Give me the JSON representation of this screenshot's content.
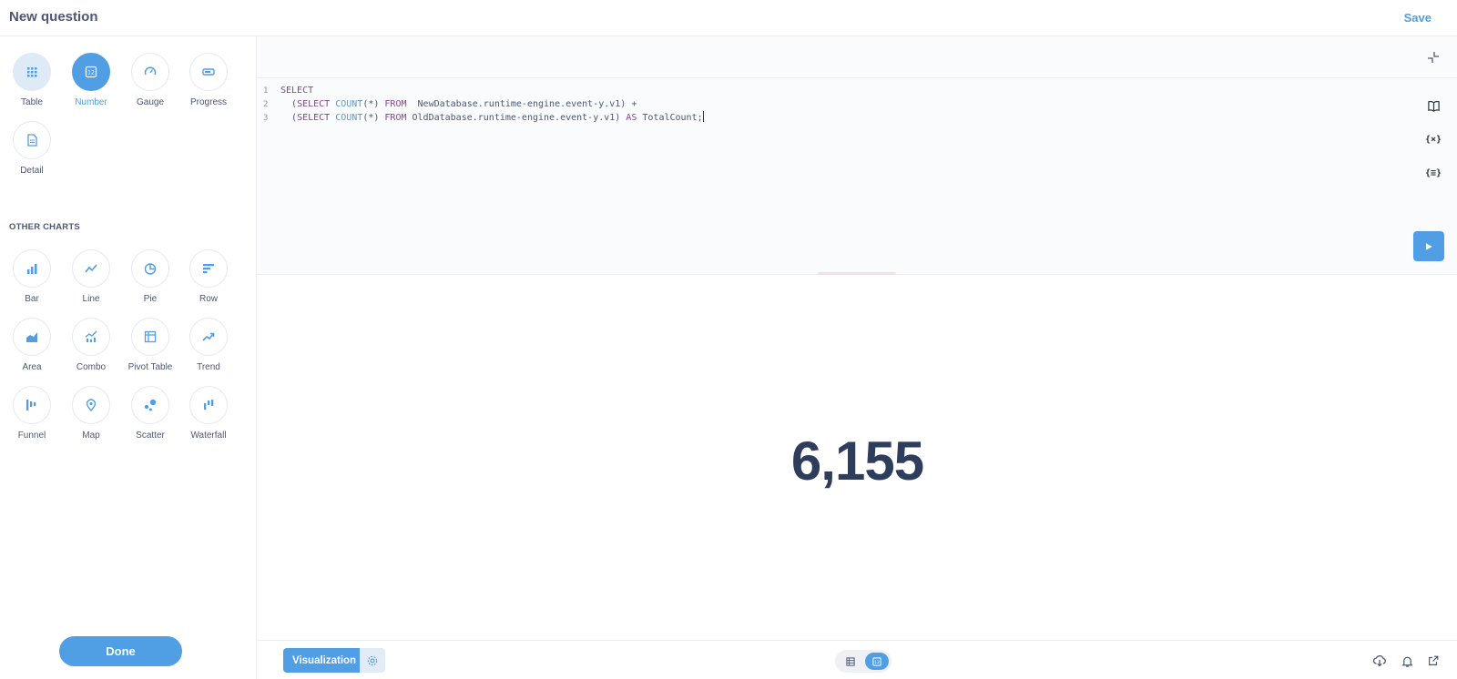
{
  "header": {
    "title": "New question",
    "save_label": "Save"
  },
  "sidebar": {
    "primary_charts": [
      {
        "label": "Table",
        "icon": "table-icon"
      },
      {
        "label": "Number",
        "icon": "number-icon"
      },
      {
        "label": "Gauge",
        "icon": "gauge-icon"
      },
      {
        "label": "Progress",
        "icon": "progress-icon"
      },
      {
        "label": "Detail",
        "icon": "detail-icon"
      }
    ],
    "selected": "Number",
    "other_charts_heading": "OTHER CHARTS",
    "other_charts": [
      {
        "label": "Bar",
        "icon": "bar-chart-icon"
      },
      {
        "label": "Line",
        "icon": "line-chart-icon"
      },
      {
        "label": "Pie",
        "icon": "pie-chart-icon"
      },
      {
        "label": "Row",
        "icon": "row-chart-icon"
      },
      {
        "label": "Area",
        "icon": "area-chart-icon"
      },
      {
        "label": "Combo",
        "icon": "combo-chart-icon"
      },
      {
        "label": "Pivot Table",
        "icon": "pivot-table-icon"
      },
      {
        "label": "Trend",
        "icon": "trend-icon"
      },
      {
        "label": "Funnel",
        "icon": "funnel-icon"
      },
      {
        "label": "Map",
        "icon": "map-pin-icon"
      },
      {
        "label": "Scatter",
        "icon": "scatter-icon"
      },
      {
        "label": "Waterfall",
        "icon": "waterfall-icon"
      }
    ],
    "done_label": "Done"
  },
  "editor": {
    "line_numbers": [
      "1",
      "2",
      "3"
    ],
    "line1": {
      "kw": "SELECT"
    },
    "line2": {
      "open": "  (",
      "kw1": "SELECT",
      "fn": " COUNT",
      "args": "(*) ",
      "kw2": "FROM",
      "rest": "  NewDatabase.runtime-engine.event-y.v1) +"
    },
    "line3": {
      "open": "  (",
      "kw1": "SELECT",
      "fn": " COUNT",
      "args": "(*) ",
      "kw2": "FROM",
      "rest": " OldDatabase.runtime-engine.event-y.v1) ",
      "kw3": "AS",
      "tail": " TotalCount;"
    }
  },
  "result": {
    "value": "6,155"
  },
  "footer": {
    "visualization_label": "Visualization"
  },
  "colors": {
    "accent": "#509ee3",
    "text": "#4c5773",
    "number": "#2e3d5c"
  }
}
